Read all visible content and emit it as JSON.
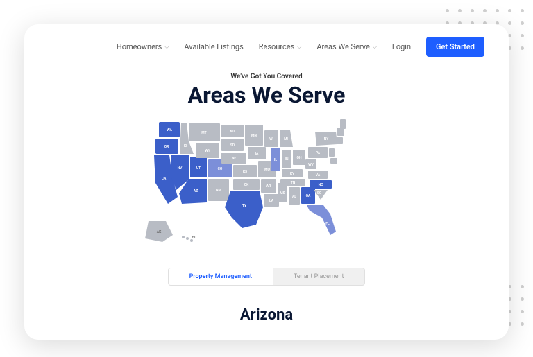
{
  "nav": {
    "items": [
      {
        "label": "Homeowners",
        "hasDropdown": true
      },
      {
        "label": "Available Listings",
        "hasDropdown": false
      },
      {
        "label": "Resources",
        "hasDropdown": true
      },
      {
        "label": "Areas We Serve",
        "hasDropdown": true
      }
    ],
    "login": "Login",
    "cta": "Get Started"
  },
  "hero": {
    "subtitle": "We've Got You Covered",
    "title": "Areas We Serve"
  },
  "tabs": {
    "active": "Property Management",
    "inactive": "Tenant Placement"
  },
  "selectedState": "Arizona",
  "map": {
    "servedStates": [
      "WA",
      "OR",
      "CA",
      "NV",
      "UT",
      "AZ",
      "CO",
      "TX",
      "IL",
      "GA",
      "NC",
      "FL"
    ],
    "colors": {
      "served": "#3b5fc9",
      "highlight": "#7c8fd9",
      "inactive": "#b8bcc4"
    }
  }
}
